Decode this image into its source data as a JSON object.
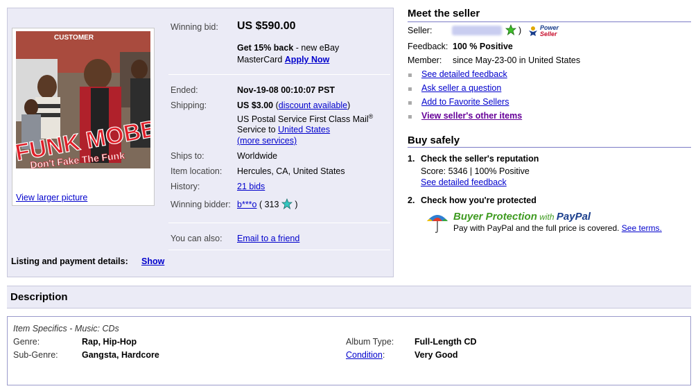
{
  "item": {
    "image_alt": "Funk Mobb - Don't Fake The Funk album cover",
    "cover_text": {
      "title": "FUNK MOBB",
      "subtitle": "Don't Fake The Funk",
      "shirt": "CUSTOMER"
    },
    "view_larger": "View larger picture",
    "winning_bid_label": "Winning bid:",
    "winning_bid_value": "US $590.00",
    "promo_bold": "Get 15% back",
    "promo_rest": " - new eBay",
    "promo_line2": "MasterCard ",
    "promo_link": "Apply Now",
    "ended_label": "Ended:",
    "ended_value": "Nov-19-08 00:10:07 PST",
    "shipping_label": "Shipping:",
    "shipping_cost": "US $3.00",
    "shipping_paren_open": " (",
    "shipping_discount_link": "discount available",
    "shipping_paren_close": ")",
    "shipping_service": "US Postal Service First Class Mail",
    "shipping_reg": "®",
    "shipping_service2": "Service to ",
    "shipping_dest_link": "United States",
    "shipping_more_link": "(more services)",
    "ships_to_label": "Ships to:",
    "ships_to_value": "Worldwide",
    "location_label": "Item location:",
    "location_value": "Hercules, CA, United States",
    "history_label": "History:",
    "history_link": "21 bids",
    "bidder_label": "Winning bidder:",
    "bidder_link": "b***o",
    "bidder_score": " ( 313 ",
    "bidder_close": " )",
    "also_label": "You can also:",
    "also_link": "Email to a friend",
    "listing_label": "Listing and payment details:",
    "listing_link": "Show"
  },
  "seller": {
    "title": "Meet the seller",
    "seller_label": "Seller:",
    "seller_close": ")",
    "power_seller_1": "Power",
    "power_seller_2": "Seller",
    "feedback_label": "Feedback:",
    "feedback_value": "100 % Positive",
    "member_label": "Member:",
    "member_value": "since May-23-00 in United States",
    "links": [
      "See detailed feedback",
      "Ask seller a question",
      "Add to Favorite Sellers",
      "View seller's other items"
    ]
  },
  "buy_safely": {
    "title": "Buy safely",
    "step1_num": "1.",
    "step1_title": "Check the seller's reputation",
    "step1_score": "Score: 5346 | 100% Positive",
    "step1_link": "See detailed feedback",
    "step2_num": "2.",
    "step2_title": "Check how you're protected",
    "bp_title": "Buyer Protection",
    "bp_with": " with ",
    "bp_paypal": "PayPal",
    "bp_text": "Pay with PayPal and the full price is covered. ",
    "bp_link": "See terms."
  },
  "description": {
    "title": "Description",
    "specifics_title": "Item Specifics - Music: CDs",
    "genre_label": "Genre:",
    "genre_value": "Rap, Hip-Hop",
    "subgenre_label": "Sub-Genre:",
    "subgenre_value": "Gangsta, Hardcore",
    "album_type_label": "Album Type:",
    "album_type_value": "Full-Length CD",
    "condition_link": "Condition",
    "condition_colon": ":",
    "condition_value": "Very Good"
  },
  "colors": {
    "panel_bg": "#ebebf6",
    "link": "#0000cc",
    "visited_link": "#660099",
    "section_rule": "#7b7bc6",
    "paypal_green": "#3f9b21",
    "paypal_blue": "#1a3e8c"
  }
}
